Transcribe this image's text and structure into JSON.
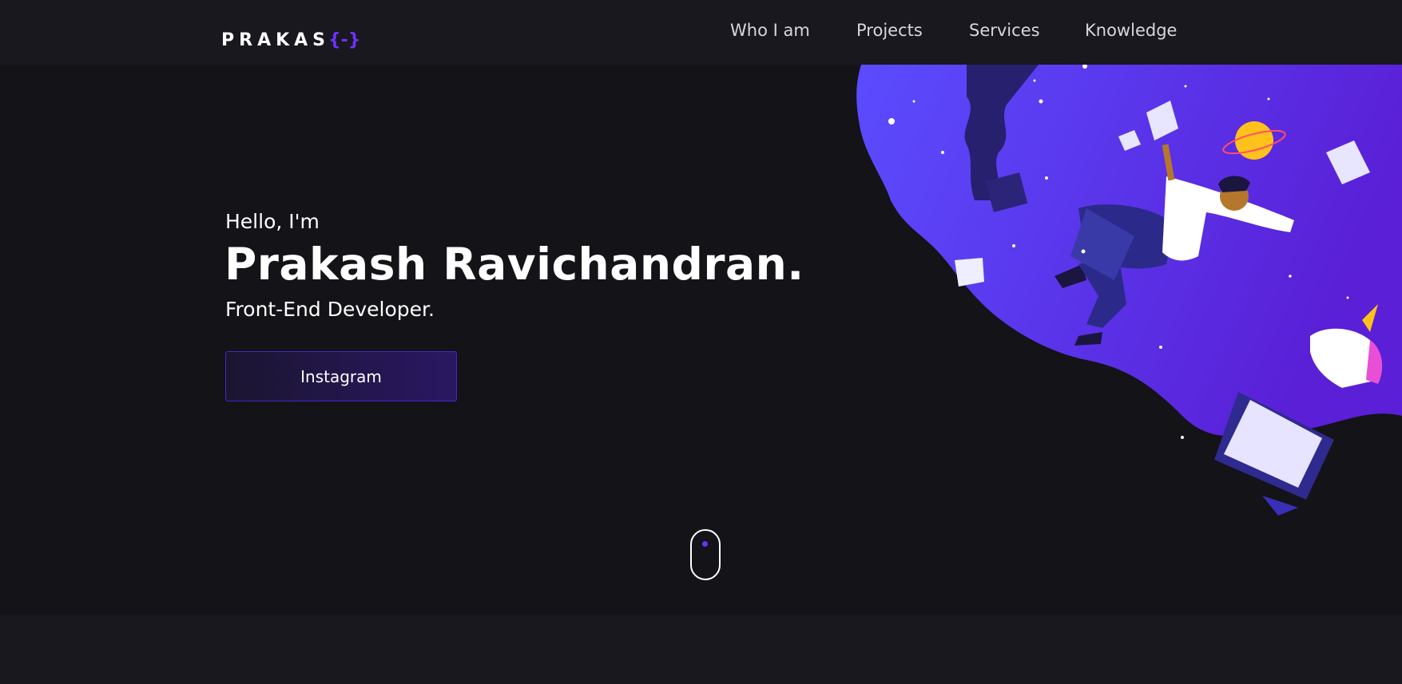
{
  "header": {
    "logo_text": "PRAKAS",
    "logo_brace": "{-}",
    "nav": [
      {
        "label": "Who I am"
      },
      {
        "label": "Projects"
      },
      {
        "label": "Services"
      },
      {
        "label": "Knowledge"
      }
    ]
  },
  "hero": {
    "greeting": "Hello, I'm",
    "name": "Prakash Ravichandran.",
    "role": "Front-End Developer.",
    "cta_label": "Instagram"
  },
  "illustration": {
    "icon": "space-developer-illustration",
    "gradient_start": "#5b4cff",
    "gradient_end": "#5a1fd6"
  },
  "colors": {
    "background": "#131318",
    "header_bg": "#18181e",
    "accent": "#6d31ff"
  },
  "scroll_indicator": {
    "icon": "mouse-scroll-icon"
  }
}
